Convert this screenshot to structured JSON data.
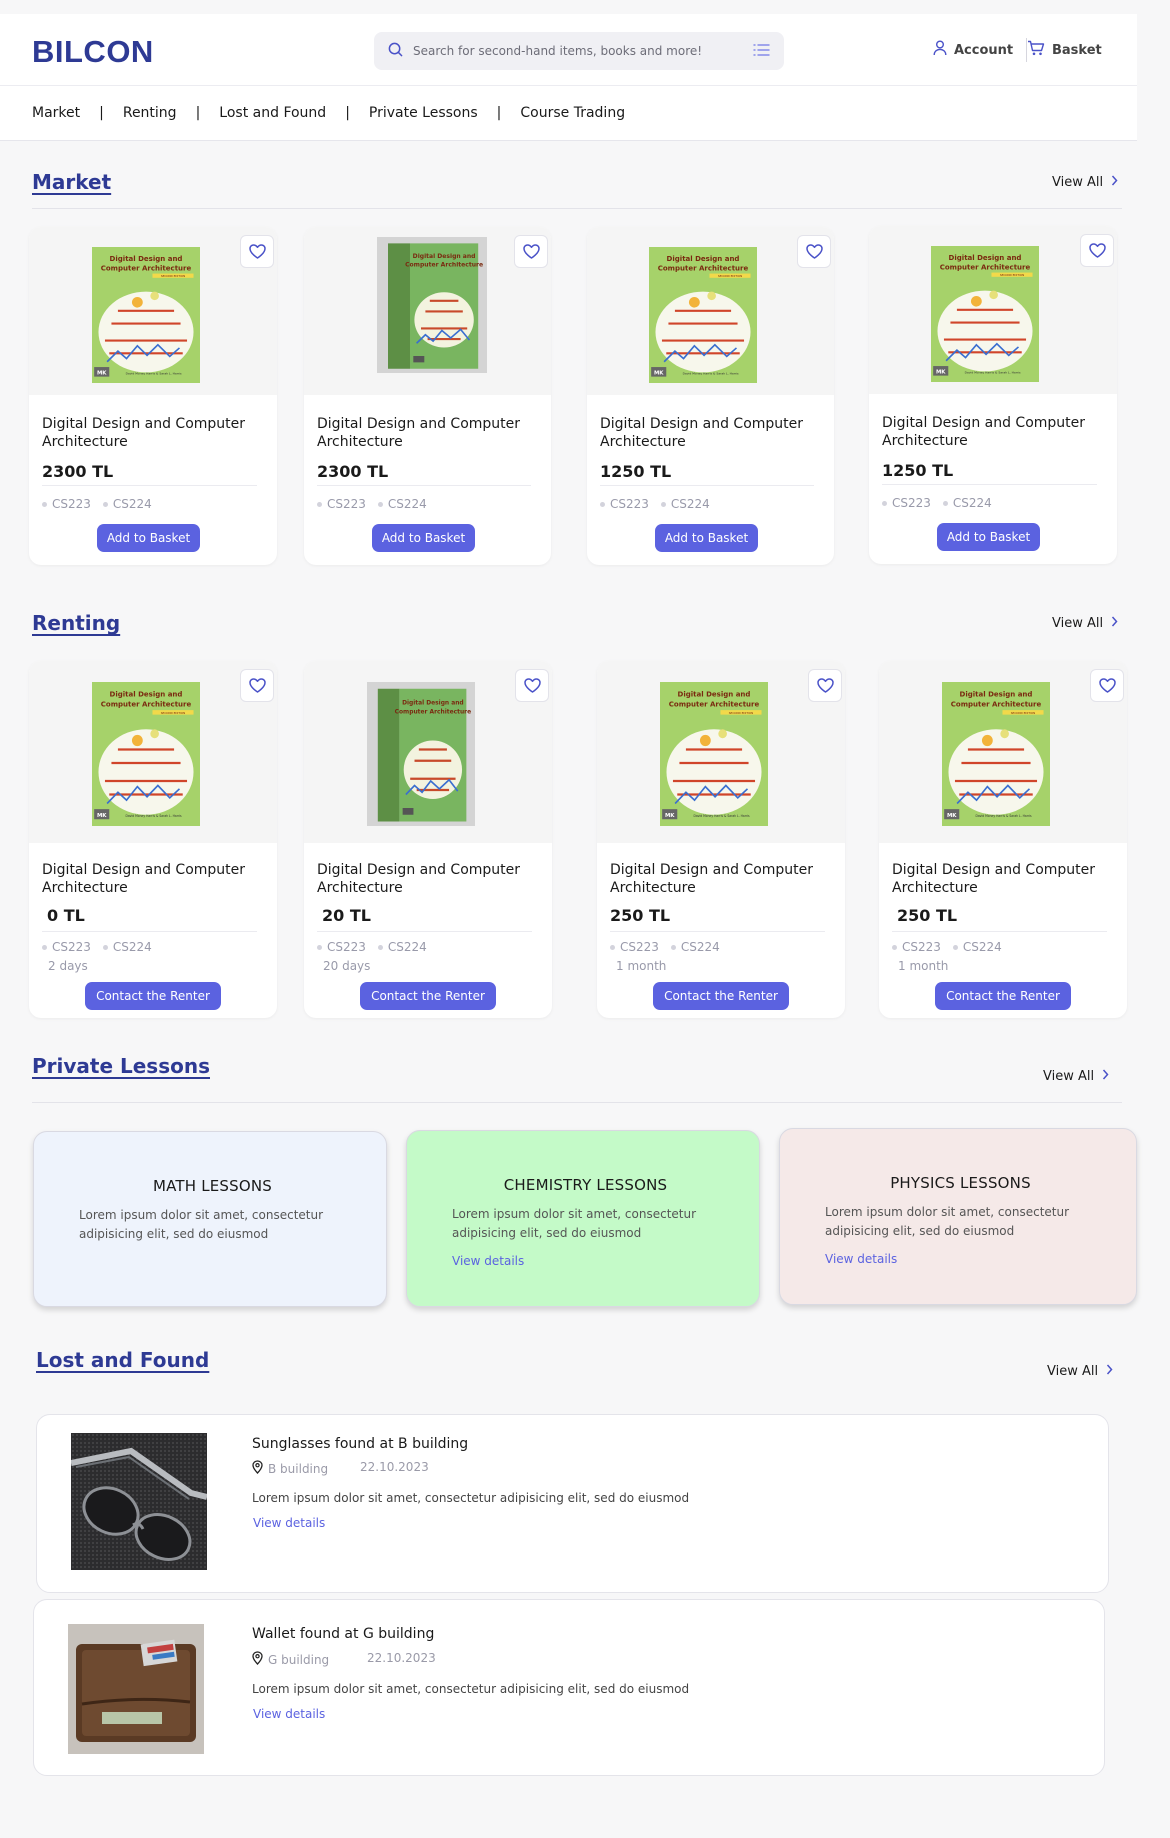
{
  "header": {
    "logo": "BILCON",
    "search_placeholder": "Search for second-hand items, books and more!",
    "account_label": "Account",
    "basket_label": "Basket"
  },
  "nav": {
    "items": [
      "Market",
      "Renting",
      "Lost and Found",
      "Private Lessons",
      "Course Trading"
    ],
    "separator": "|"
  },
  "market": {
    "title": "Market",
    "view_all": "View All",
    "cards": [
      {
        "title": "Digital Design and Computer Architecture",
        "price": "2300 TL",
        "tags": [
          "CS223",
          "CS224"
        ],
        "button": "Add to Basket"
      },
      {
        "title": "Digital Design and Computer Architecture",
        "price": "2300 TL",
        "tags": [
          "CS223",
          "CS224"
        ],
        "button": "Add to Basket"
      },
      {
        "title": "Digital Design and Computer Architecture",
        "price": "1250 TL",
        "tags": [
          "CS223",
          "CS224"
        ],
        "button": "Add to Basket"
      },
      {
        "title": "Digital Design and Computer Architecture",
        "price": "1250 TL",
        "tags": [
          "CS223",
          "CS224"
        ],
        "button": "Add to Basket"
      }
    ]
  },
  "renting": {
    "title": "Renting",
    "view_all": "View All",
    "cards": [
      {
        "title": "Digital Design and Computer Architecture",
        "price": "0 TL",
        "tags": [
          "CS223",
          "CS224"
        ],
        "duration": "2 days",
        "button": "Contact the Renter"
      },
      {
        "title": "Digital Design and Computer Architecture",
        "price": "20 TL",
        "tags": [
          "CS223",
          "CS224"
        ],
        "duration": "20 days",
        "button": "Contact the Renter"
      },
      {
        "title": "Digital Design and Computer Architecture",
        "price": "250 TL",
        "tags": [
          "CS223",
          "CS224"
        ],
        "duration": "1 month",
        "button": "Contact the Renter"
      },
      {
        "title": "Digital Design and Computer Architecture",
        "price": "250 TL",
        "tags": [
          "CS223",
          "CS224"
        ],
        "duration": "1 month",
        "button": "Contact the Renter"
      }
    ]
  },
  "book_cover": {
    "line1": "Digital Design and",
    "line2": "Computer Architecture",
    "edition": "SECOND EDITION",
    "publisher": "MK",
    "authors": "David Money Harris & Sarah L. Harris"
  },
  "private_lessons": {
    "title": "Private Lessons",
    "view_all": "View All",
    "cards": [
      {
        "title": "MATH LESSONS",
        "text": "Lorem ipsum dolor sit amet, consectetur adipisicing elit, sed do eiusmod",
        "link": "",
        "color": "#eef3fc"
      },
      {
        "title": "CHEMISTRY LESSONS",
        "text": "Lorem ipsum dolor sit amet, consectetur adipisicing elit, sed do eiusmod",
        "link": "View details",
        "color": "#c4fac8"
      },
      {
        "title": "PHYSICS LESSONS",
        "text": "Lorem ipsum dolor sit amet, consectetur adipisicing elit, sed do eiusmod",
        "link": "View details",
        "color": "#f5e9e8"
      }
    ]
  },
  "lost_found": {
    "title": "Lost and Found",
    "view_all": "View All",
    "items": [
      {
        "title": "Sunglasses found at B building",
        "location": "B building",
        "date": "22.10.2023",
        "text": "Lorem ipsum dolor sit amet, consectetur adipisicing elit, sed do eiusmod",
        "link": "View details"
      },
      {
        "title": "Wallet found at G building",
        "location": "G building",
        "date": "22.10.2023",
        "text": "Lorem ipsum dolor sit amet, consectetur adipisicing elit, sed do eiusmod",
        "link": "View details"
      }
    ]
  },
  "colors": {
    "brand": "#2e3a94",
    "accent": "#5b62e0"
  }
}
